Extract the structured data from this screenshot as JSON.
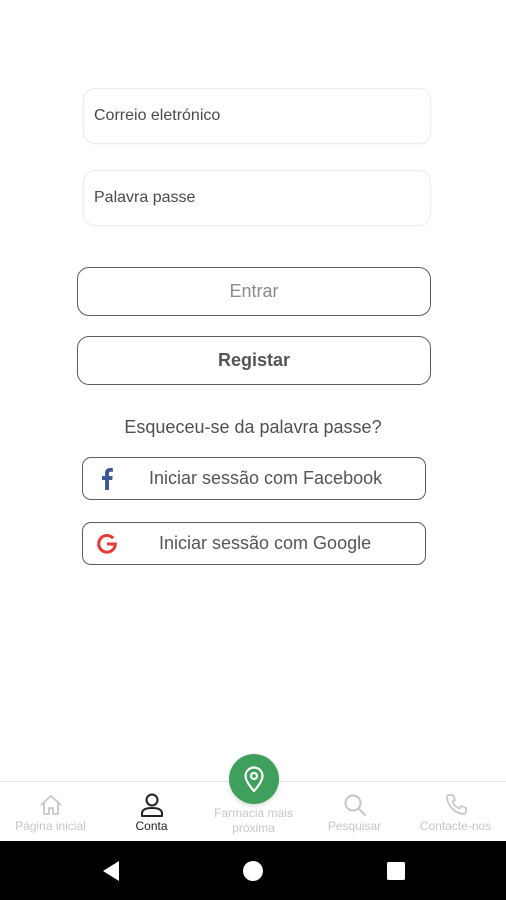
{
  "form": {
    "email": {
      "placeholder": "Correio eletrónico",
      "value": ""
    },
    "password": {
      "placeholder": "Palavra passe",
      "value": ""
    }
  },
  "actions": {
    "enter_label": "Entrar",
    "register_label": "Registar",
    "forgot_label": "Esqueceu-se da palavra passe?",
    "facebook_label": "Iniciar sessão com Facebook",
    "google_label": "Iniciar sessão com Google"
  },
  "bottom_nav": {
    "active": "Conta",
    "items": [
      {
        "label": "Página inicial",
        "icon": "home-icon"
      },
      {
        "label": "Conta",
        "icon": "user-icon"
      },
      {
        "label": "Farmacia mais próxima",
        "icon": "location-pin-icon"
      },
      {
        "label": "Pesquisar",
        "icon": "search-icon"
      },
      {
        "label": "Contacte-nos",
        "icon": "phone-icon"
      }
    ]
  },
  "colors": {
    "accent_green": "#3fa05d",
    "facebook_blue": "#3b5998",
    "google_red": "#e53935",
    "inactive_nav": "#c6c6c6"
  },
  "system_nav": {
    "icons": [
      "back-icon",
      "home-circle-icon",
      "recent-apps-icon"
    ]
  }
}
